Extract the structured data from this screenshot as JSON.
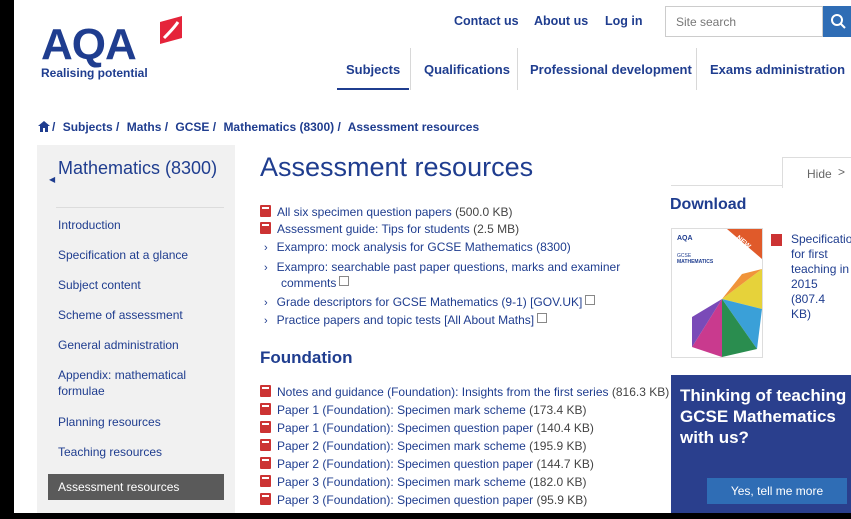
{
  "brand": {
    "logo_text": "AQA",
    "tagline": "Realising potential",
    "logo_color": "#1f3d8f",
    "flag_color": "#e5243a"
  },
  "toplinks": [
    "Contact us",
    "About us",
    "Log in"
  ],
  "search": {
    "placeholder": "Site search",
    "icon": "search-icon"
  },
  "mainnav": [
    "Subjects",
    "Qualifications",
    "Professional development",
    "Exams administration"
  ],
  "breadcrumb": {
    "home_icon": "home-icon",
    "items": [
      "Subjects /",
      "Maths /",
      "GCSE /",
      "Mathematics (8300) /",
      "Assessment resources"
    ]
  },
  "sidebar": {
    "title": "Mathematics (8300)",
    "items": [
      "Introduction",
      "Specification at a glance",
      "Subject content",
      "Scheme of assessment",
      "General administration",
      "Appendix: mathematical formulae",
      "Planning resources",
      "Teaching resources"
    ],
    "active": "Assessment resources"
  },
  "main": {
    "title": "Assessment resources",
    "top_rows": [
      {
        "type": "pdf",
        "text": "All six specimen question papers",
        "size": "(500.0 KB)"
      },
      {
        "type": "pdf",
        "text": "Assessment guide: Tips for students",
        "size": "(2.5 MB)"
      },
      {
        "type": "link",
        "text": "Exampro: mock analysis for GCSE Mathematics (8300)",
        "size": ""
      },
      {
        "type": "link",
        "text": "Exampro: searchable past paper questions, marks and examiner",
        "size": ""
      },
      {
        "type": "cont",
        "text": "comments",
        "size": ""
      },
      {
        "type": "link",
        "text": "Grade descriptors for GCSE Mathematics (9-1) [GOV.UK]",
        "size": ""
      },
      {
        "type": "link",
        "text": "Practice papers and topic tests [All About Maths]",
        "size": ""
      }
    ],
    "foundation_heading": "Foundation",
    "foundation_rows": [
      {
        "text": "Notes and guidance (Foundation): Insights from the first series",
        "size": "(816.3 KB)"
      },
      {
        "text": "Paper 1 (Foundation): Specimen mark scheme",
        "size": "(173.4 KB)"
      },
      {
        "text": "Paper 1 (Foundation): Specimen question paper",
        "size": "(140.4 KB)"
      },
      {
        "text": "Paper 2 (Foundation): Specimen mark scheme",
        "size": "(195.9 KB)"
      },
      {
        "text": "Paper 2 (Foundation): Specimen question paper",
        "size": "(144.7 KB)"
      },
      {
        "text": "Paper 3 (Foundation): Specimen mark scheme",
        "size": "(182.0 KB)"
      },
      {
        "text": "Paper 3 (Foundation): Specimen question paper",
        "size": "(95.9 KB)"
      }
    ]
  },
  "right": {
    "hide_label": "Hide",
    "download_title": "Download",
    "cover": {
      "logo": "AQA",
      "badge": "NEW",
      "line1": "GCSE",
      "line2": "MATHEMATICS"
    },
    "spec_lines": [
      "Specification",
      "for first",
      "teaching in",
      "2015 (807.4",
      "KB)"
    ],
    "promo_title": "Thinking of teaching GCSE Mathematics with us?",
    "promo_button": "Yes, tell me more"
  }
}
